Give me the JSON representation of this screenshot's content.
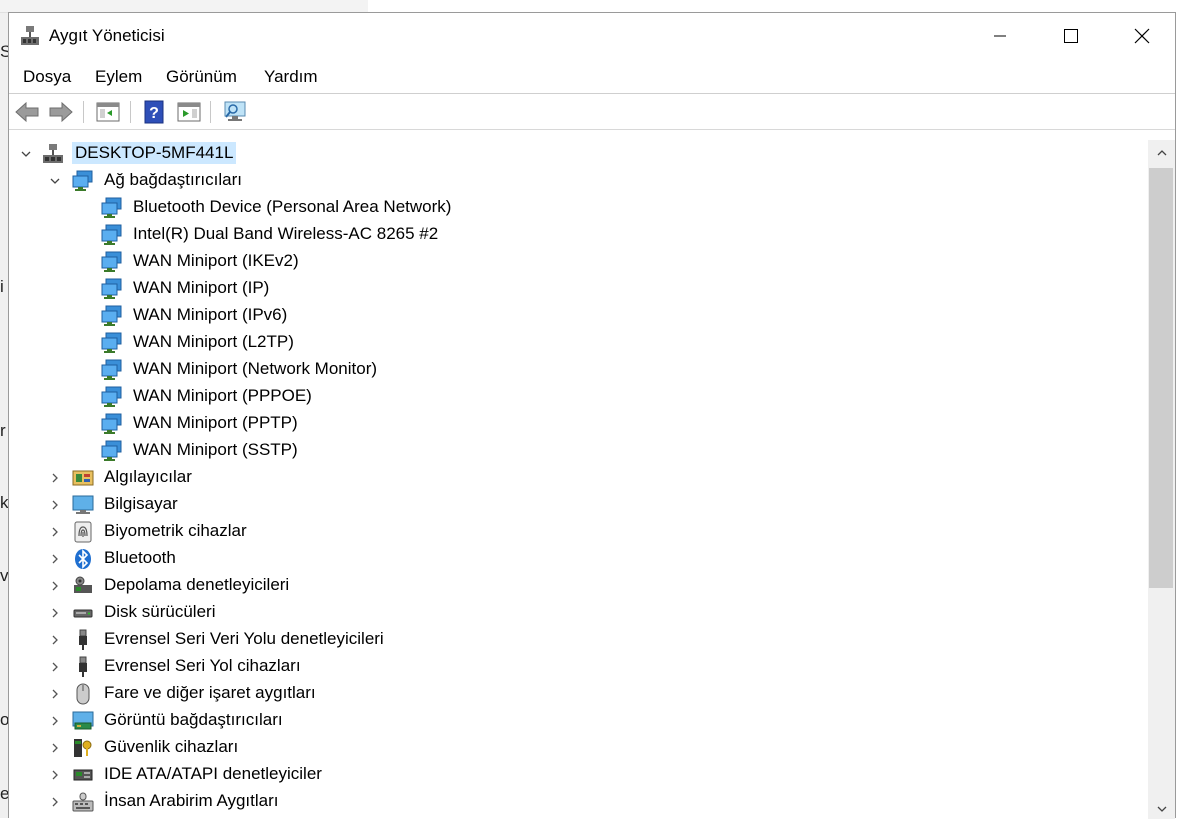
{
  "window": {
    "title": "Aygıt Yöneticisi",
    "title_icon": "device-manager-icon"
  },
  "background_chars": [
    "S",
    "i",
    "r",
    "k",
    "v",
    "o",
    "e"
  ],
  "menu": [
    {
      "label": "Dosya"
    },
    {
      "label": "Eylem"
    },
    {
      "label": "Görünüm"
    },
    {
      "label": "Yardım"
    }
  ],
  "toolbar": [
    {
      "name": "back-button",
      "icon": "arrow-left-icon"
    },
    {
      "name": "forward-button",
      "icon": "arrow-right-icon"
    },
    {
      "name": "properties-button",
      "icon": "properties-icon"
    },
    {
      "name": "help-button",
      "icon": "help-icon"
    },
    {
      "name": "run-button",
      "icon": "run-icon"
    },
    {
      "name": "scan-hardware-button",
      "icon": "monitor-search-icon"
    }
  ],
  "tree": {
    "root": {
      "label": "DESKTOP-5MF441L",
      "icon": "computer-network-icon",
      "expanded": true
    },
    "network": {
      "label": "Ağ bağdaştırıcıları",
      "icon": "network-adapter-icon",
      "expanded": true,
      "children": [
        "Bluetooth Device (Personal Area Network)",
        "Intel(R) Dual Band Wireless-AC 8265 #2",
        "WAN Miniport (IKEv2)",
        "WAN Miniport (IP)",
        "WAN Miniport (IPv6)",
        "WAN Miniport (L2TP)",
        "WAN Miniport (Network Monitor)",
        "WAN Miniport (PPPOE)",
        "WAN Miniport (PPTP)",
        "WAN Miniport (SSTP)"
      ]
    },
    "categories": [
      {
        "label": "Algılayıcılar",
        "icon": "sensor-icon"
      },
      {
        "label": "Bilgisayar",
        "icon": "computer-icon"
      },
      {
        "label": "Biyometrik cihazlar",
        "icon": "fingerprint-icon"
      },
      {
        "label": "Bluetooth",
        "icon": "bluetooth-icon"
      },
      {
        "label": "Depolama denetleyicileri",
        "icon": "storage-controller-icon"
      },
      {
        "label": "Disk sürücüleri",
        "icon": "disk-drive-icon"
      },
      {
        "label": "Evrensel Seri Veri Yolu denetleyicileri",
        "icon": "usb-icon"
      },
      {
        "label": "Evrensel Seri Yol cihazları",
        "icon": "usb-icon"
      },
      {
        "label": "Fare ve diğer işaret aygıtları",
        "icon": "mouse-icon"
      },
      {
        "label": "Görüntü bağdaştırıcıları",
        "icon": "display-adapter-icon"
      },
      {
        "label": "Güvenlik cihazları",
        "icon": "security-device-icon"
      },
      {
        "label": "IDE ATA/ATAPI denetleyiciler",
        "icon": "ide-controller-icon"
      },
      {
        "label": "İnsan Arabirim Aygıtları",
        "icon": "hid-icon"
      }
    ]
  },
  "colors": {
    "selection": "#cce8ff",
    "scrollbar_thumb": "#cdcdcd",
    "network_icon": "#3a8fd8"
  }
}
